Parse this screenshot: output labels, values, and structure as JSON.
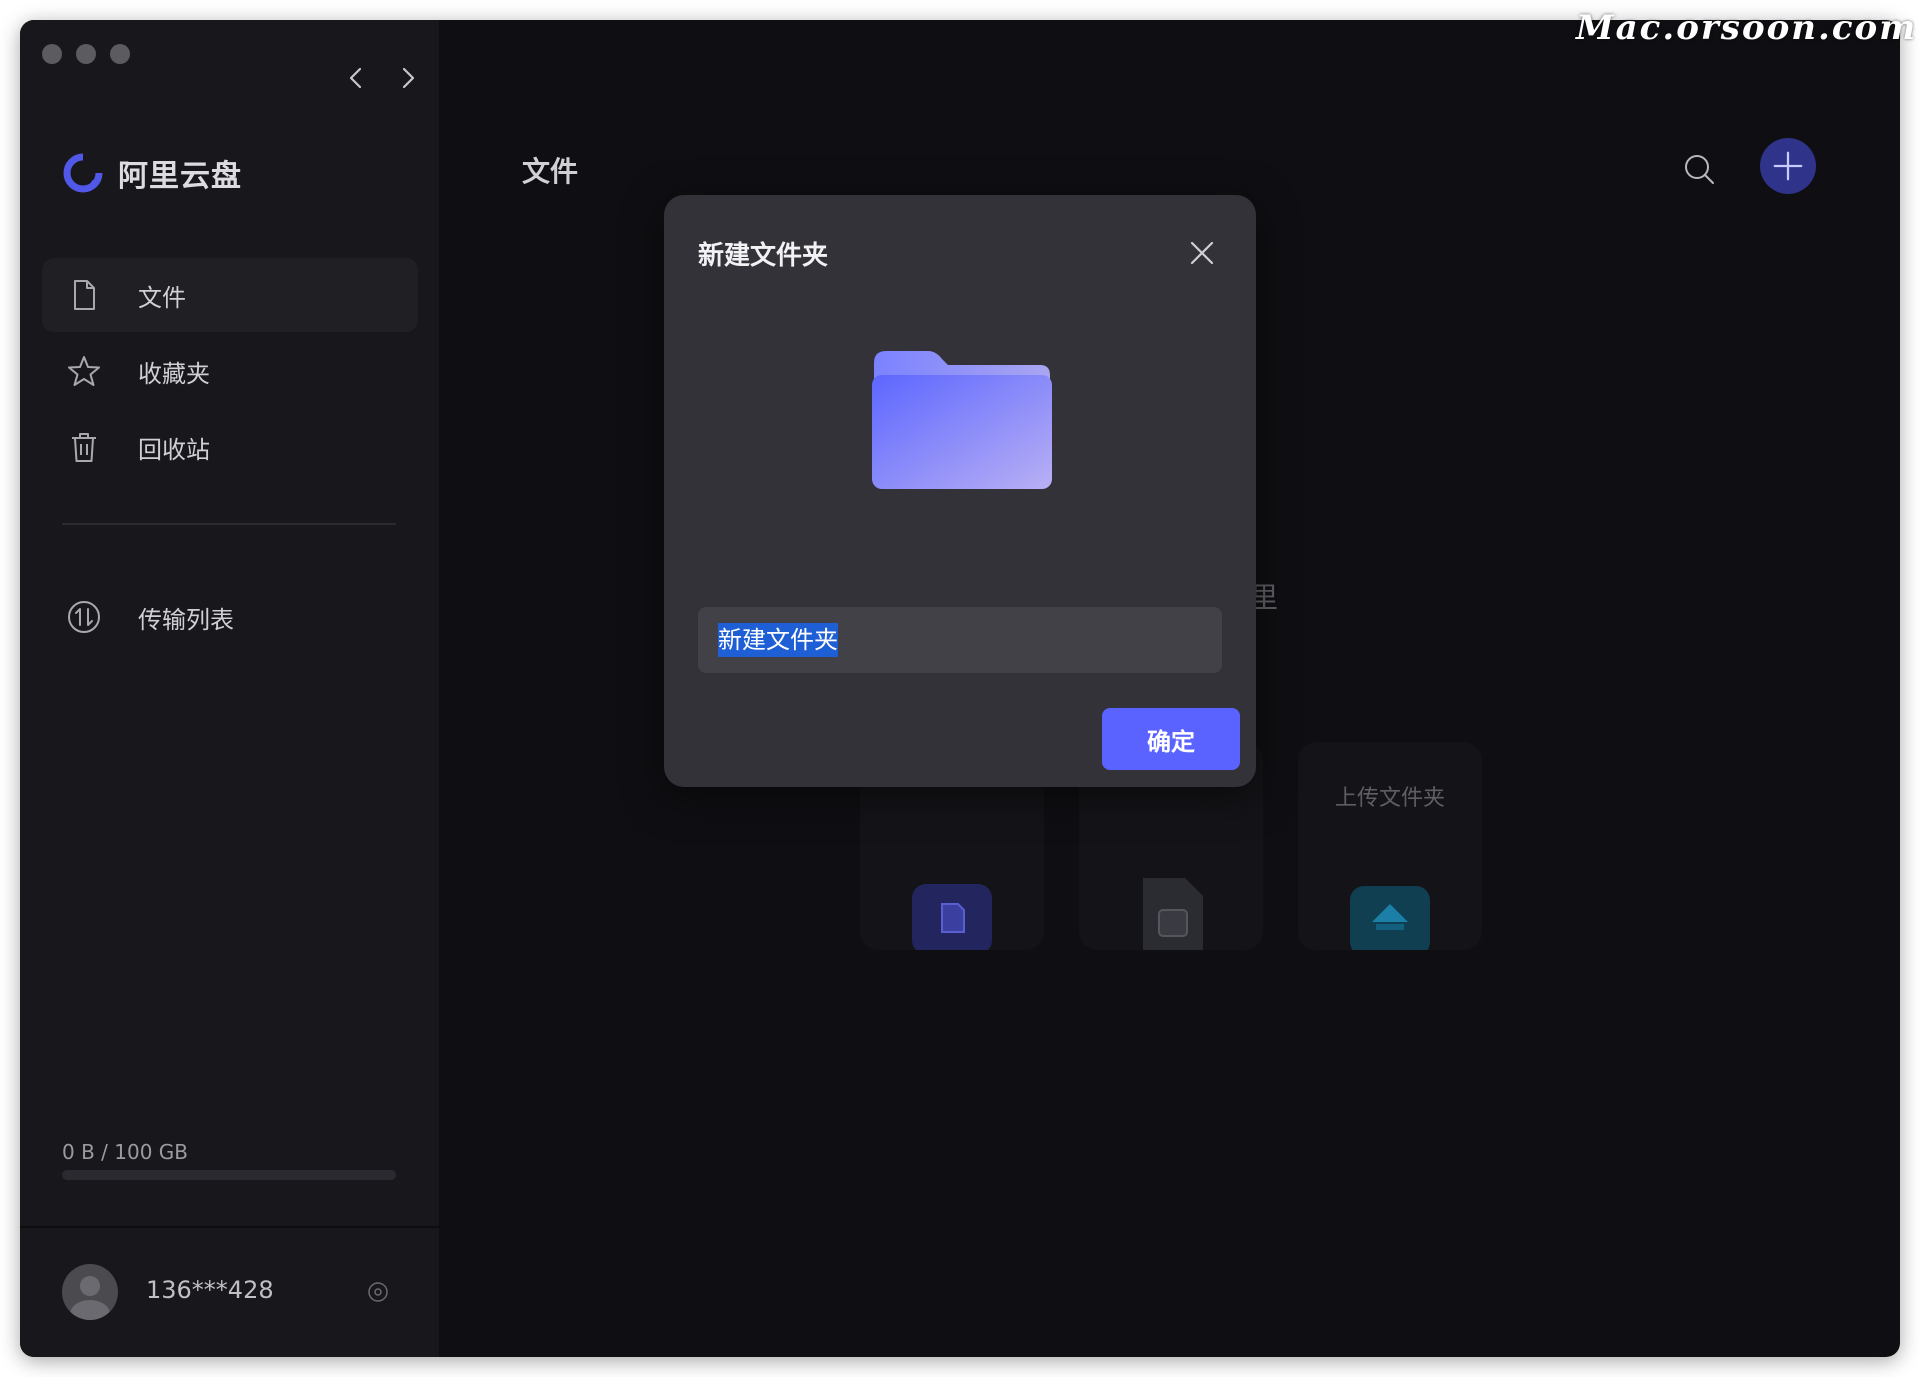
{
  "watermark": "Mac.orsoon.com",
  "app": {
    "name": "阿里云盘"
  },
  "sidebar": {
    "items": [
      {
        "label": "文件",
        "icon": "file-icon",
        "active": true
      },
      {
        "label": "收藏夹",
        "icon": "star-icon",
        "active": false
      },
      {
        "label": "回收站",
        "icon": "trash-icon",
        "active": false
      }
    ],
    "transfer": {
      "label": "传输列表",
      "icon": "transfer-icon"
    },
    "storage": {
      "text": "0 B / 100 GB",
      "used_fraction": 0
    },
    "user": {
      "name": "136***428"
    }
  },
  "main": {
    "title": "文件",
    "empty_hint_fragment": "里",
    "quick_actions": [
      {
        "label": "",
        "icon": "upload-file-icon"
      },
      {
        "label": "",
        "icon": "new-doc-icon"
      },
      {
        "label": "上传文件夹",
        "icon": "upload-folder-icon"
      }
    ]
  },
  "dialog": {
    "title": "新建文件夹",
    "input_value": "新建文件夹",
    "confirm_label": "确定"
  },
  "colors": {
    "accent": "#5a62ff",
    "window_bg": "#0f0f13",
    "sidebar_bg": "#18181c",
    "dialog_bg": "#323238",
    "selection": "#1f5fd6"
  }
}
